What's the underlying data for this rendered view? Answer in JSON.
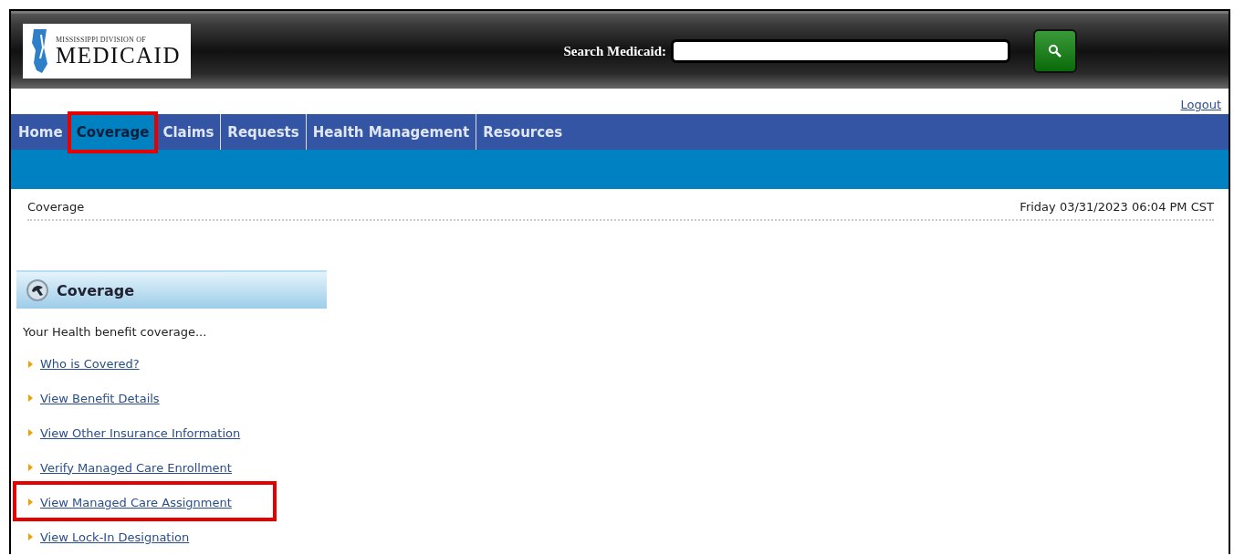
{
  "logo": {
    "line1": "MISSISSIPPI DIVISION OF",
    "line2": "MEDICAID"
  },
  "search": {
    "label": "Search Medicaid:"
  },
  "logout": "Logout",
  "tabs": [
    {
      "label": "Home",
      "selected": false,
      "highlighted": false
    },
    {
      "label": "Coverage",
      "selected": true,
      "highlighted": true
    },
    {
      "label": "Claims",
      "selected": false,
      "highlighted": false
    },
    {
      "label": "Requests",
      "selected": false,
      "highlighted": false
    },
    {
      "label": "Health Management",
      "selected": false,
      "highlighted": false
    },
    {
      "label": "Resources",
      "selected": false,
      "highlighted": false
    }
  ],
  "breadcrumb": "Coverage",
  "datetime": "Friday 03/31/2023 06:04 PM CST",
  "panel": {
    "title": "Coverage",
    "intro": "Your Health benefit coverage...",
    "links": [
      {
        "label": "Who is Covered?",
        "highlighted": false
      },
      {
        "label": "View Benefit Details",
        "highlighted": false
      },
      {
        "label": "View Other Insurance Information",
        "highlighted": false
      },
      {
        "label": "Verify Managed Care Enrollment",
        "highlighted": false
      },
      {
        "label": "View Managed Care Assignment",
        "highlighted": true
      },
      {
        "label": "View Lock-In Designation",
        "highlighted": false
      }
    ]
  }
}
